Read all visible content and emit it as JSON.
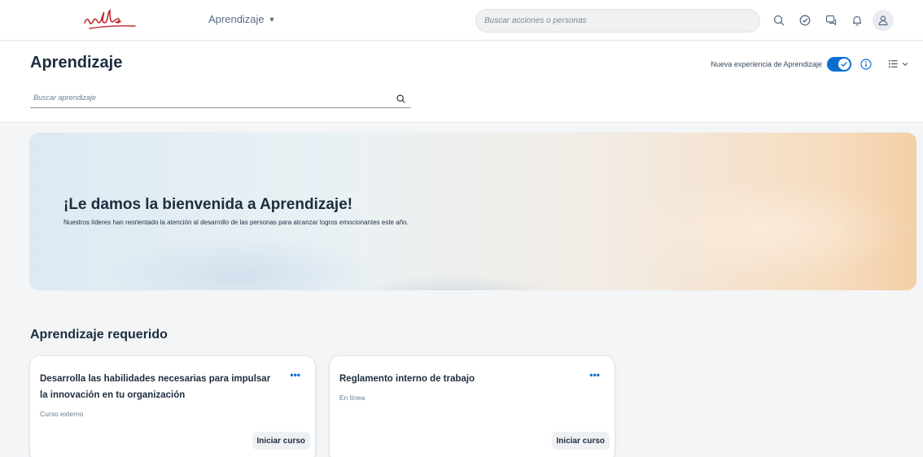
{
  "app": {
    "logo_text": "udla",
    "nav_menu_label": "Aprendizaje",
    "global_search_placeholder": "Buscar acciones o personas",
    "shell_icons": [
      "search-icon",
      "check-circle-icon",
      "chat-icon",
      "bell-icon",
      "user-icon"
    ]
  },
  "header": {
    "title": "Aprendizaje",
    "search_placeholder": "Buscar aprendizaje",
    "toggle_label": "Nueva experiencia de Aprendizaje",
    "toggle_on": true
  },
  "hero": {
    "title": "¡Le damos la bienvenida a Aprendizaje!",
    "subtitle": "Nuestros líderes han reorientado la atención al desarrollo de las personas para alcanzar logros emocionantes este año."
  },
  "required_section": {
    "title": "Aprendizaje requerido",
    "cards": [
      {
        "title": "Desarrolla las habilidades necesarias para impulsar la innovación en tu organización",
        "meta": "Curso externo",
        "more_label": "•••",
        "button_label": "Iniciar curso"
      },
      {
        "title": "Reglamento interno de trabajo",
        "meta": "En línea",
        "more_label": "•••",
        "button_label": "Iniciar curso"
      }
    ]
  },
  "colors": {
    "accent": "#0a6ed1",
    "text": "#1d2d3e",
    "background": "#f3f5f7"
  }
}
